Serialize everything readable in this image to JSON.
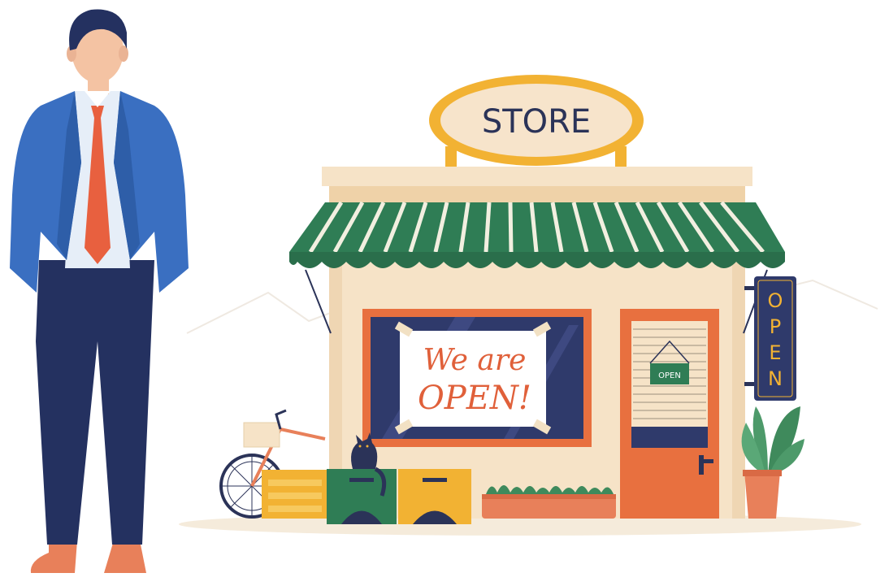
{
  "store_sign": {
    "text": "STORE"
  },
  "window_poster": {
    "line1": "We are",
    "line2": "OPEN!"
  },
  "door_sign": {
    "text": "OPEN"
  },
  "vertical_sign": {
    "letters": [
      "O",
      "P",
      "E",
      "N"
    ]
  },
  "colors": {
    "awning_green": "#2f7d55",
    "awning_stripe": "#f2efe0",
    "wall": "#f6e3c7",
    "wall_trim": "#f2d9b5",
    "sign_orange": "#f2b233",
    "door_orange": "#e8703f",
    "window_navy": "#2f3a6b",
    "suit_blue": "#3a6fc1",
    "pants_navy": "#243160",
    "tie_red": "#e8603f",
    "plant_green": "#4d9a6a"
  }
}
